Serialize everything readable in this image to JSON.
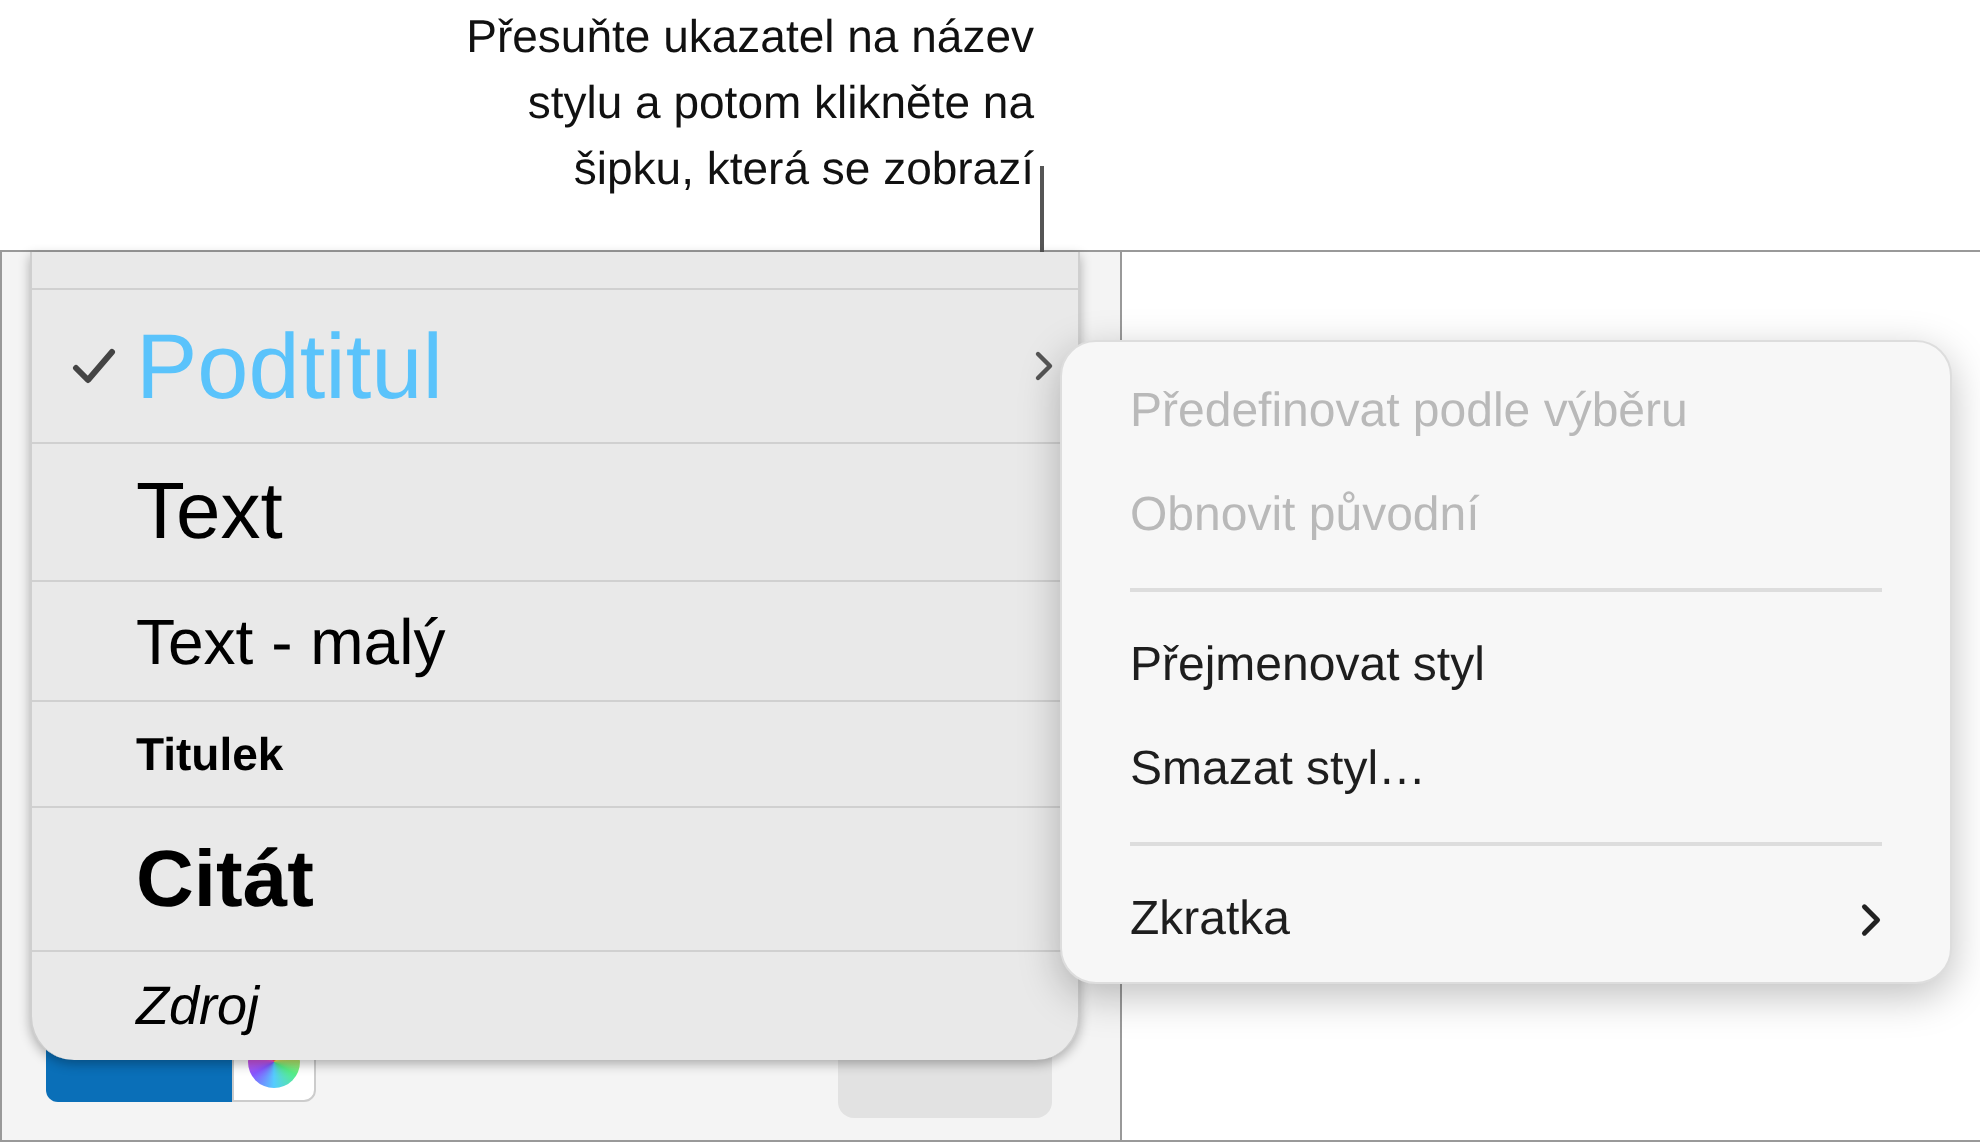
{
  "callout": {
    "lines": [
      "Přesuňte ukazatel na název",
      "stylu a potom klikněte na",
      "šipku, která se zobrazí"
    ]
  },
  "styles": [
    {
      "name": "Podtitul",
      "kind": "subtitle",
      "selected": true
    },
    {
      "name": "Text",
      "kind": "body",
      "selected": false
    },
    {
      "name": "Text - malý",
      "kind": "small",
      "selected": false
    },
    {
      "name": "Titulek",
      "kind": "caption",
      "selected": false
    },
    {
      "name": "Citát",
      "kind": "quote",
      "selected": false
    },
    {
      "name": "Zdroj",
      "kind": "source",
      "selected": false
    }
  ],
  "menu": {
    "groups": [
      [
        {
          "label": "Předefinovat podle výběru",
          "disabled": true,
          "submenu": false
        },
        {
          "label": "Obnovit původní",
          "disabled": true,
          "submenu": false
        }
      ],
      [
        {
          "label": "Přejmenovat styl",
          "disabled": false,
          "submenu": false
        },
        {
          "label": "Smazat styl…",
          "disabled": false,
          "submenu": false
        }
      ],
      [
        {
          "label": "Zkratka",
          "disabled": false,
          "submenu": true
        }
      ]
    ]
  }
}
